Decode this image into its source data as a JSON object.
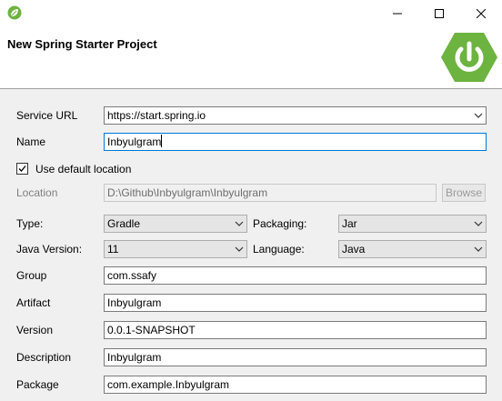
{
  "window": {
    "title_icon": "spring-leaf-icon",
    "controls": [
      "minimize-icon",
      "maximize-icon",
      "close-icon"
    ]
  },
  "banner": {
    "title": "New Spring Starter Project",
    "logo_icon": "spring-power-icon",
    "logo_color": "#6db33f"
  },
  "form": {
    "service_url": {
      "label": "Service URL",
      "value": "https://start.spring.io"
    },
    "name": {
      "label": "Name",
      "value": "Inbyulgram"
    },
    "use_default_location": {
      "label": "Use default location",
      "checked": true
    },
    "location": {
      "label": "Location",
      "value": "D:\\Github\\Inbyulgram\\Inbyulgram",
      "browse_label": "Browse"
    },
    "type": {
      "label": "Type:",
      "value": "Gradle"
    },
    "packaging": {
      "label": "Packaging:",
      "value": "Jar"
    },
    "java_version": {
      "label": "Java Version:",
      "value": "11"
    },
    "language": {
      "label": "Language:",
      "value": "Java"
    },
    "group": {
      "label": "Group",
      "value": "com.ssafy"
    },
    "artifact": {
      "label": "Artifact",
      "value": "Inbyulgram"
    },
    "version": {
      "label": "Version",
      "value": "0.0.1-SNAPSHOT"
    },
    "description": {
      "label": "Description",
      "value": "Inbyulgram"
    },
    "package": {
      "label": "Package",
      "value": "com.example.Inbyulgram"
    }
  },
  "colors": {
    "focus_border": "#0078d7"
  }
}
